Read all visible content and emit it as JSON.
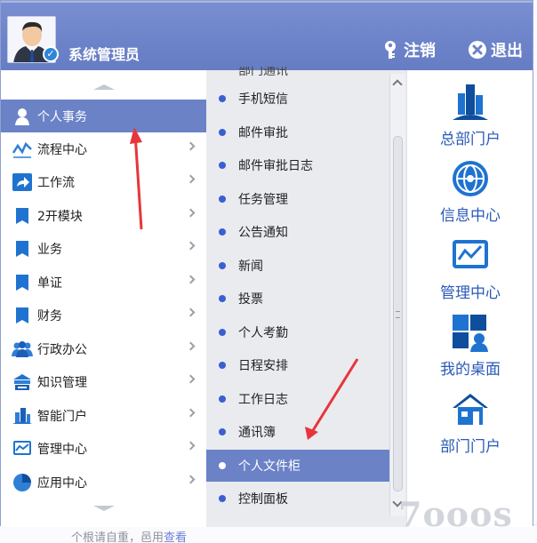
{
  "header": {
    "username": "系统管理员",
    "logout_label": "注销",
    "exit_label": "退出"
  },
  "left_menu": {
    "items": [
      {
        "label": "个人事务",
        "icon": "person-icon",
        "active": true
      },
      {
        "label": "流程中心",
        "icon": "flow-chart-icon"
      },
      {
        "label": "工作流",
        "icon": "share-arrow-icon"
      },
      {
        "label": "2开模块",
        "icon": "module-icon"
      },
      {
        "label": "业务",
        "icon": "module-icon"
      },
      {
        "label": "单证",
        "icon": "module-icon"
      },
      {
        "label": "财务",
        "icon": "module-icon"
      },
      {
        "label": "行政办公",
        "icon": "group-icon"
      },
      {
        "label": "知识管理",
        "icon": "knowledge-icon"
      },
      {
        "label": "智能门户",
        "icon": "buildings-icon"
      },
      {
        "label": "管理中心",
        "icon": "monitor-chart-icon"
      },
      {
        "label": "应用中心",
        "icon": "pie-chart-icon"
      }
    ]
  },
  "sub_menu": {
    "partial_top": "部门通讯",
    "items": [
      {
        "label": "手机短信"
      },
      {
        "label": "邮件审批"
      },
      {
        "label": "邮件审批日志"
      },
      {
        "label": "任务管理"
      },
      {
        "label": "公告通知"
      },
      {
        "label": "新闻"
      },
      {
        "label": "投票"
      },
      {
        "label": "个人考勤"
      },
      {
        "label": "日程安排"
      },
      {
        "label": "工作日志"
      },
      {
        "label": "通讯簿"
      },
      {
        "label": "个人文件柜",
        "active": true
      },
      {
        "label": "控制面板"
      }
    ]
  },
  "portal_menu": {
    "items": [
      {
        "label": "总部门户",
        "icon": "buildings-icon"
      },
      {
        "label": "信息中心",
        "icon": "globe-icon"
      },
      {
        "label": "管理中心",
        "icon": "monitor-chart-icon"
      },
      {
        "label": "我的桌面",
        "icon": "desktop-tiles-icon"
      },
      {
        "label": "部门门户",
        "icon": "house-icon"
      }
    ]
  },
  "background": {
    "text_prefix": "个根请自重，邑用",
    "link_text": "查看"
  },
  "watermark": "7ooos",
  "colors": {
    "header": "#6d83c9",
    "active": "#6b82c7",
    "link": "#2a5ab8",
    "annotation_arrow": "#e8353b"
  }
}
